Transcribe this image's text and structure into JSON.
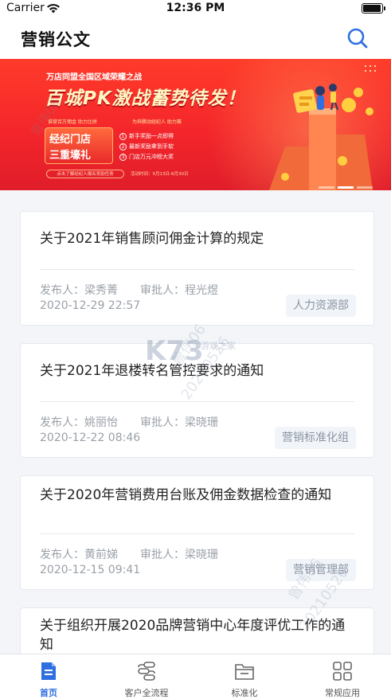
{
  "status_bar": {
    "carrier": "Carrier",
    "time": "12:36 PM"
  },
  "header": {
    "title": "营销公文",
    "search_icon": "search-icon"
  },
  "banner": {
    "subtitle": "万店同盟全国区域荣耀之战",
    "headline": "百城PK激战蓄势待发！",
    "tagline_left": "谁营百万佣金 助力比拼",
    "tagline_right": "为奔腾动经纪人 助力赛",
    "gift_line1": "经纪门店",
    "gift_line2": "三重壕礼",
    "rewards": [
      "新手奖励一点即得",
      "最新奖励拿到手软",
      "门店万元冲榜大奖"
    ],
    "cta": "点击了解经纪人报名奖励任务",
    "date": "活动时间：5月13日-6月30日",
    "slide_count": 3,
    "active_slide": 2
  },
  "notices": [
    {
      "title": "关于2021年销售顾问佣金计算的规定",
      "publisher_label": "发布人：",
      "publisher": "梁秀菁",
      "approver_label": "审批人：",
      "approver": "程光煜",
      "date": "2020-12-29 22:57",
      "department": "人力资源部"
    },
    {
      "title": "关于2021年退楼转名管控要求的通知",
      "publisher_label": "发布人：",
      "publisher": "姚丽怡",
      "approver_label": "审批人：",
      "approver": "梁晓珊",
      "date": "2020-12-22 08:46",
      "department": "营销标准化组"
    },
    {
      "title": "关于2020年营销费用台账及佣金数据检查的通知",
      "publisher_label": "发布人：",
      "publisher": "黄前娣",
      "approver_label": "审批人：",
      "approver": "梁晓珊",
      "date": "2020-12-15 09:41",
      "department": "营销管理部"
    },
    {
      "title": "关于组织开展2020品牌营销中心年度评优工作的通知"
    }
  ],
  "watermark": {
    "site": "K73",
    "site_sub": "游戏之家",
    "text_a": "曾伟06",
    "text_b": "20210526"
  },
  "tab_bar": {
    "tabs": [
      {
        "label": "首页",
        "icon": "document-icon",
        "active": true
      },
      {
        "label": "客户全流程",
        "icon": "flow-icon",
        "active": false
      },
      {
        "label": "标准化",
        "icon": "folder-icon",
        "active": false
      },
      {
        "label": "常规应用",
        "icon": "grid-apps-icon",
        "active": false
      }
    ]
  },
  "colors": {
    "accent": "#2f6fe0",
    "banner_red": "#f4262b",
    "meta_gray": "#9aa0a8"
  }
}
